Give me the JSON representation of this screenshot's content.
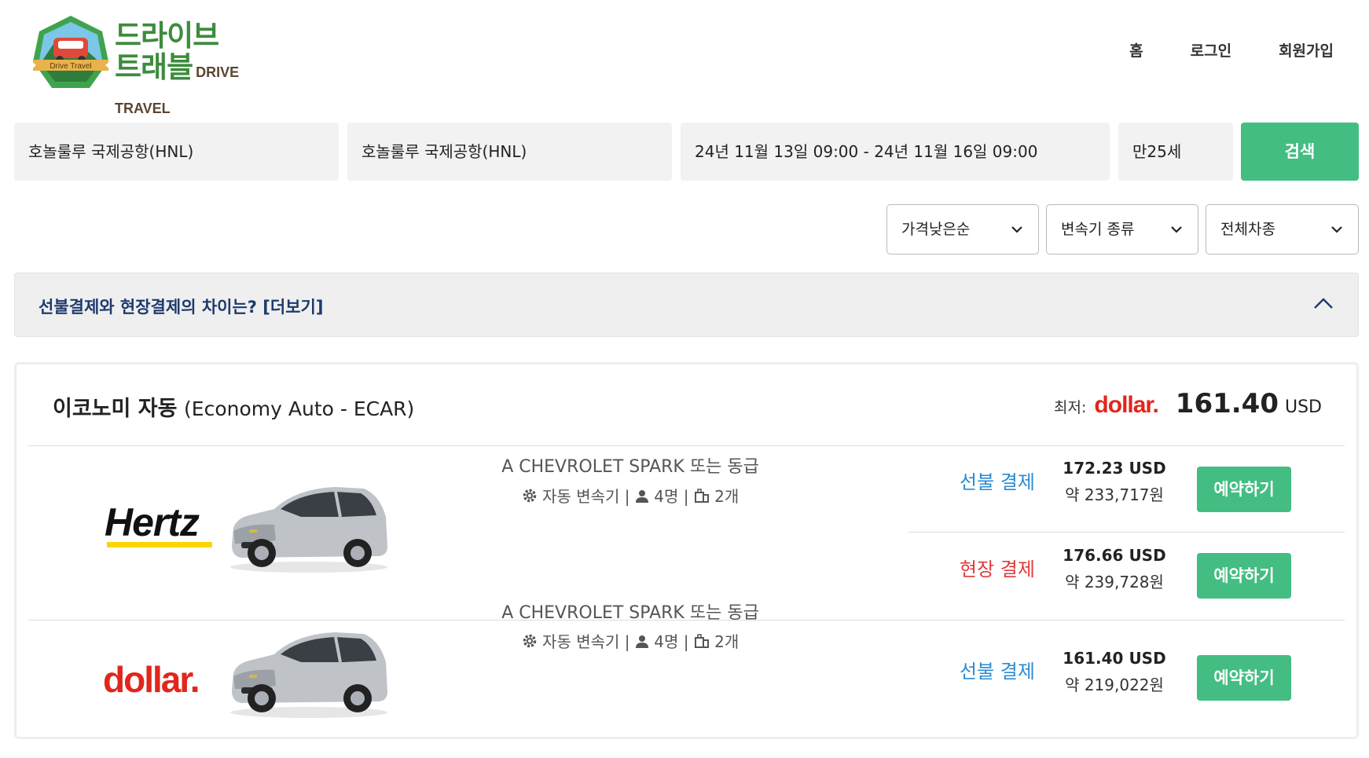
{
  "header": {
    "logo": {
      "line1": "드라이브",
      "line2": "트래블",
      "english": "DRIVE TRAVEL",
      "badge_text": "Drive Travel"
    },
    "nav": [
      "홈",
      "로그인",
      "회원가입"
    ]
  },
  "search": {
    "pickup": "호놀룰루 국제공항(HNL)",
    "dropoff": "호놀룰루 국제공항(HNL)",
    "dates": "24년 11월 13일 09:00 - 24년 11월 16일 09:00",
    "age": "만25세",
    "button": "검색"
  },
  "filters": {
    "sort": "가격낮은순",
    "transmission": "변속기 종류",
    "car_type": "전체차종"
  },
  "info": {
    "text": "선불결제와 현장결제의 차이는? [더보기]"
  },
  "result": {
    "title_main": "이코노미 자동",
    "title_sub": "(Economy Auto - ECAR)",
    "best_label": "최저:",
    "best_vendor": "dollar.",
    "best_price": "161.40",
    "best_currency": "USD",
    "offers": [
      {
        "vendor": "Hertz",
        "model": "A CHEVROLET SPARK 또는 동급",
        "transmission": "자동 변속기 |",
        "passengers": "4명 |",
        "luggage": "2개",
        "options": [
          {
            "label": "선불 결제",
            "usd": "172.23 USD",
            "krw": "약 233,717원",
            "button": "예약하기"
          },
          {
            "label": "현장 결제",
            "usd": "176.66 USD",
            "krw": "약 239,728원",
            "button": "예약하기"
          }
        ]
      },
      {
        "vendor": "dollar.",
        "model": "A CHEVROLET SPARK 또는 동급",
        "transmission": "자동 변속기 |",
        "passengers": "4명 |",
        "luggage": "2개",
        "options": [
          {
            "label": "선불 결제",
            "usd": "161.40 USD",
            "krw": "약 219,022원",
            "button": "예약하기"
          }
        ]
      }
    ]
  },
  "colors": {
    "accent_green": "#44bd83",
    "prepay_blue": "#2a8bd1",
    "onsite_red": "#e03a3a",
    "dollar_red": "#e1261c",
    "hertz_yellow": "#ffd400"
  }
}
